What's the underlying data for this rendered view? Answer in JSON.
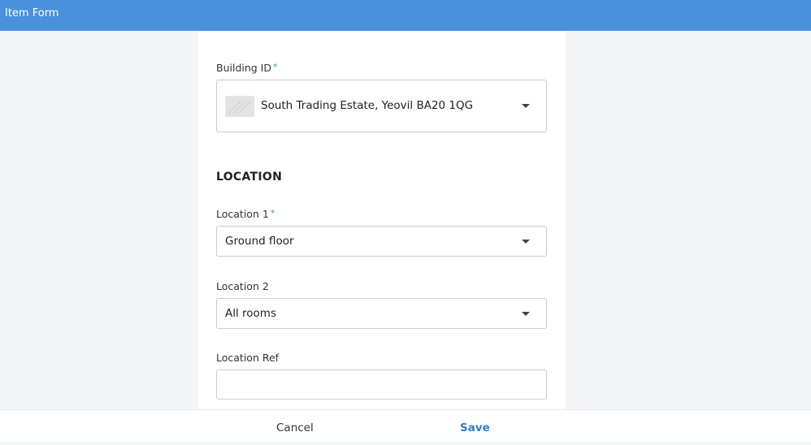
{
  "window": {
    "title": "Item Form"
  },
  "form": {
    "building": {
      "label": "Building ID",
      "required_mark": "*",
      "value": "South Trading Estate, Yeovil BA20 1QG"
    },
    "section_title": "LOCATION",
    "location1": {
      "label": "Location 1",
      "required_mark": "*",
      "value": "Ground floor"
    },
    "location2": {
      "label": "Location 2",
      "value": "All rooms"
    },
    "location_ref": {
      "label": "Location Ref",
      "value": ""
    }
  },
  "footer": {
    "cancel_label": "Cancel",
    "save_label": "Save"
  },
  "colors": {
    "accent": "#4a90dc",
    "save": "#2f7fd0"
  }
}
